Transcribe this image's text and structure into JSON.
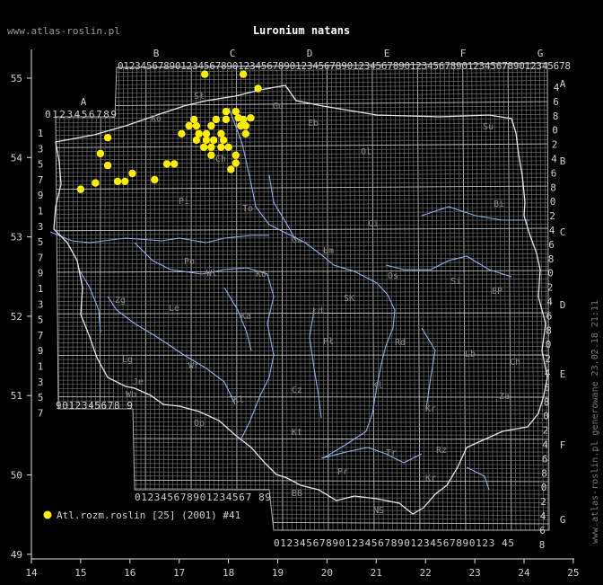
{
  "site": "www.atlas-roslin.pl",
  "title": "Luronium natans",
  "generated": "www.atlas-roslin.pl generowane 23.02.18 21:11",
  "colors": {
    "point": "#ffee00",
    "river": "#8fb0ee",
    "grid": "#7d7d7d",
    "border": "#e8e8e8"
  },
  "axes": {
    "x_ticks": [
      "14",
      "15",
      "16",
      "17",
      "18",
      "19",
      "20",
      "21",
      "22",
      "23",
      "24",
      "25"
    ],
    "y_ticks": [
      "55",
      "54",
      "53",
      "52",
      "51",
      "50",
      "49"
    ]
  },
  "grid_labels": {
    "top_letters": [
      "B",
      "C",
      "D",
      "E",
      "F",
      "G"
    ],
    "top_row": "0123456789012345678901234567890123456789012345678901234567890123456789012345678",
    "a_letter": "A",
    "a_row": "0123456789",
    "bottom_left_row": "9012345678 9",
    "bottom_mid_row": "012345678901234567 89",
    "bottom_right_row": "0123456789012345678901234567890123 45",
    "left_digits": [
      "1",
      "3",
      "5",
      "7",
      "9",
      "1",
      "3",
      "5",
      "7",
      "9",
      "1",
      "3",
      "5",
      "7",
      "9",
      "1",
      "3",
      "5",
      "7"
    ],
    "right_letters": [
      "A",
      "B",
      "C",
      "D",
      "E",
      "F",
      "G"
    ],
    "right_digits": [
      "4",
      "6",
      "8",
      "0",
      "2",
      "4",
      "6",
      "8",
      "0",
      "2",
      "4",
      "6",
      "8",
      "0",
      "2",
      "4",
      "6",
      "8",
      "0",
      "2",
      "4",
      "6",
      "8",
      "0",
      "2",
      "4",
      "6",
      "8",
      "0",
      "2",
      "4",
      "6",
      "8"
    ]
  },
  "regions": [
    "Sł",
    "Gd",
    "Eb",
    "Su",
    "Ol",
    "Ko",
    "Ch",
    "Pi",
    "Bi",
    "Ci",
    "Gw",
    "To",
    "Łm",
    "Po",
    "Wł",
    "Os",
    "Ko",
    "Si",
    "BP",
    "Zg",
    "Le",
    "Ka",
    "Łd",
    "SK",
    "Pł",
    "Rd",
    "Lb",
    "Ch",
    "Lg",
    "Wr",
    "Je",
    "Wb",
    "Kl",
    "Cz",
    "Kl",
    "Za",
    "Op",
    "Kt",
    "Kr",
    "Tr",
    "Rz",
    "BB",
    "NS",
    "Kr",
    "Pr"
  ],
  "legend": {
    "label": "Atl.rozm.roslin [25] (2001) #41"
  },
  "chart_data": {
    "type": "scatter",
    "series": [
      {
        "name": "Atl.rozm.roslin [25] (2001) #41",
        "points": [
          [
            17.52,
            55.05
          ],
          [
            18.3,
            55.05
          ],
          [
            18.6,
            54.87
          ],
          [
            17.95,
            54.58
          ],
          [
            18.15,
            54.58
          ],
          [
            17.3,
            54.48
          ],
          [
            17.75,
            54.48
          ],
          [
            17.95,
            54.48
          ],
          [
            18.2,
            54.5
          ],
          [
            18.3,
            54.48
          ],
          [
            18.45,
            54.5
          ],
          [
            17.2,
            54.4
          ],
          [
            17.35,
            54.4
          ],
          [
            17.65,
            54.4
          ],
          [
            18.25,
            54.4
          ],
          [
            18.35,
            54.4
          ],
          [
            17.05,
            54.3
          ],
          [
            17.4,
            54.3
          ],
          [
            17.55,
            54.3
          ],
          [
            17.85,
            54.3
          ],
          [
            18.35,
            54.3
          ],
          [
            17.35,
            54.22
          ],
          [
            17.55,
            54.22
          ],
          [
            17.7,
            54.22
          ],
          [
            17.9,
            54.22
          ],
          [
            15.55,
            54.25
          ],
          [
            17.5,
            54.13
          ],
          [
            17.65,
            54.13
          ],
          [
            17.85,
            54.13
          ],
          [
            18.0,
            54.13
          ],
          [
            15.4,
            54.05
          ],
          [
            17.65,
            54.03
          ],
          [
            18.15,
            54.03
          ],
          [
            16.75,
            53.92
          ],
          [
            16.9,
            53.92
          ],
          [
            15.55,
            53.9
          ],
          [
            18.15,
            53.93
          ],
          [
            18.05,
            53.85
          ],
          [
            16.05,
            53.8
          ],
          [
            15.75,
            53.7
          ],
          [
            15.9,
            53.7
          ],
          [
            16.5,
            53.72
          ],
          [
            15.3,
            53.68
          ],
          [
            15.0,
            53.6
          ]
        ]
      }
    ],
    "xlim": [
      14,
      25
    ],
    "ylim": [
      49,
      55.5
    ]
  }
}
